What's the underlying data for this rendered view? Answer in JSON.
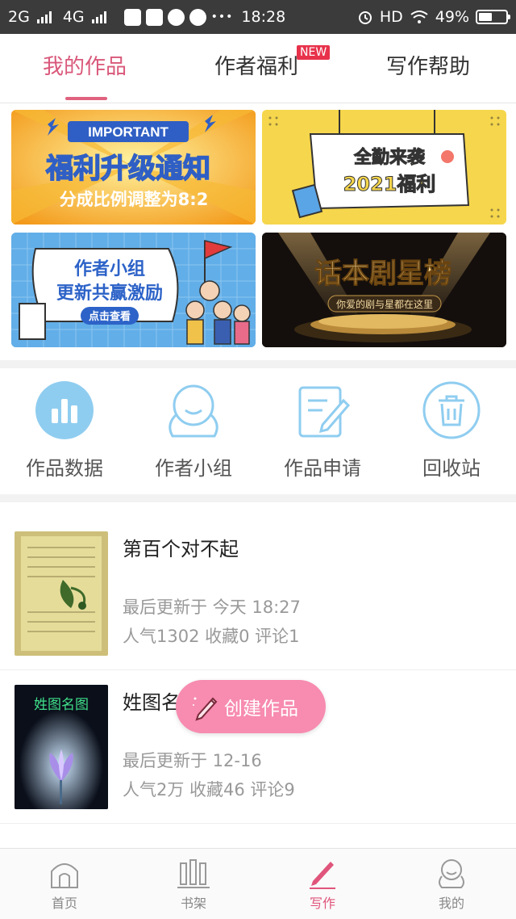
{
  "status_bar": {
    "network_1": "2G",
    "network_2": "4G",
    "time": "18:28",
    "hd": "HD",
    "battery": "49%",
    "more": "•••"
  },
  "tabs": [
    {
      "label": "我的作品",
      "active": true
    },
    {
      "label": "作者福利",
      "badge": "NEW"
    },
    {
      "label": "写作帮助"
    }
  ],
  "banners": {
    "b1": {
      "tag": "IMPORTANT",
      "title": "福利升级通知",
      "sub": "分成比例调整为8:2"
    },
    "b2": {
      "line1": "全勤来袭",
      "line2": "2021福利"
    },
    "b3": {
      "line1": "作者小组",
      "line2": "更新共赢激励",
      "button": "点击查看"
    },
    "b4": {
      "title": "话本剧星榜",
      "sub": "你爱的剧与星都在这里"
    }
  },
  "tools": [
    {
      "label": "作品数据",
      "icon": "bar-chart-icon"
    },
    {
      "label": "作者小组",
      "icon": "group-icon"
    },
    {
      "label": "作品申请",
      "icon": "edit-form-icon"
    },
    {
      "label": "回收站",
      "icon": "trash-icon"
    }
  ],
  "works": [
    {
      "title": "第百个对不起",
      "updated": "最后更新于 今天 18:27",
      "stats": "人气1302 收藏0 评论1"
    },
    {
      "title": "姓图名",
      "updated": "最后更新于 12-16",
      "stats": "人气2万 收藏46 评论9",
      "cover_text": [
        "姓图名图"
      ]
    }
  ],
  "fab": {
    "label": "创建作品"
  },
  "bottom_nav": [
    {
      "label": "首页",
      "icon": "home-icon"
    },
    {
      "label": "书架",
      "icon": "bookshelf-icon"
    },
    {
      "label": "写作",
      "icon": "pen-icon",
      "active": true
    },
    {
      "label": "我的",
      "icon": "profile-icon"
    }
  ],
  "colors": {
    "accent": "#e0627f",
    "fab": "#f78bb0",
    "icon_blue": "#5fb3e6"
  }
}
